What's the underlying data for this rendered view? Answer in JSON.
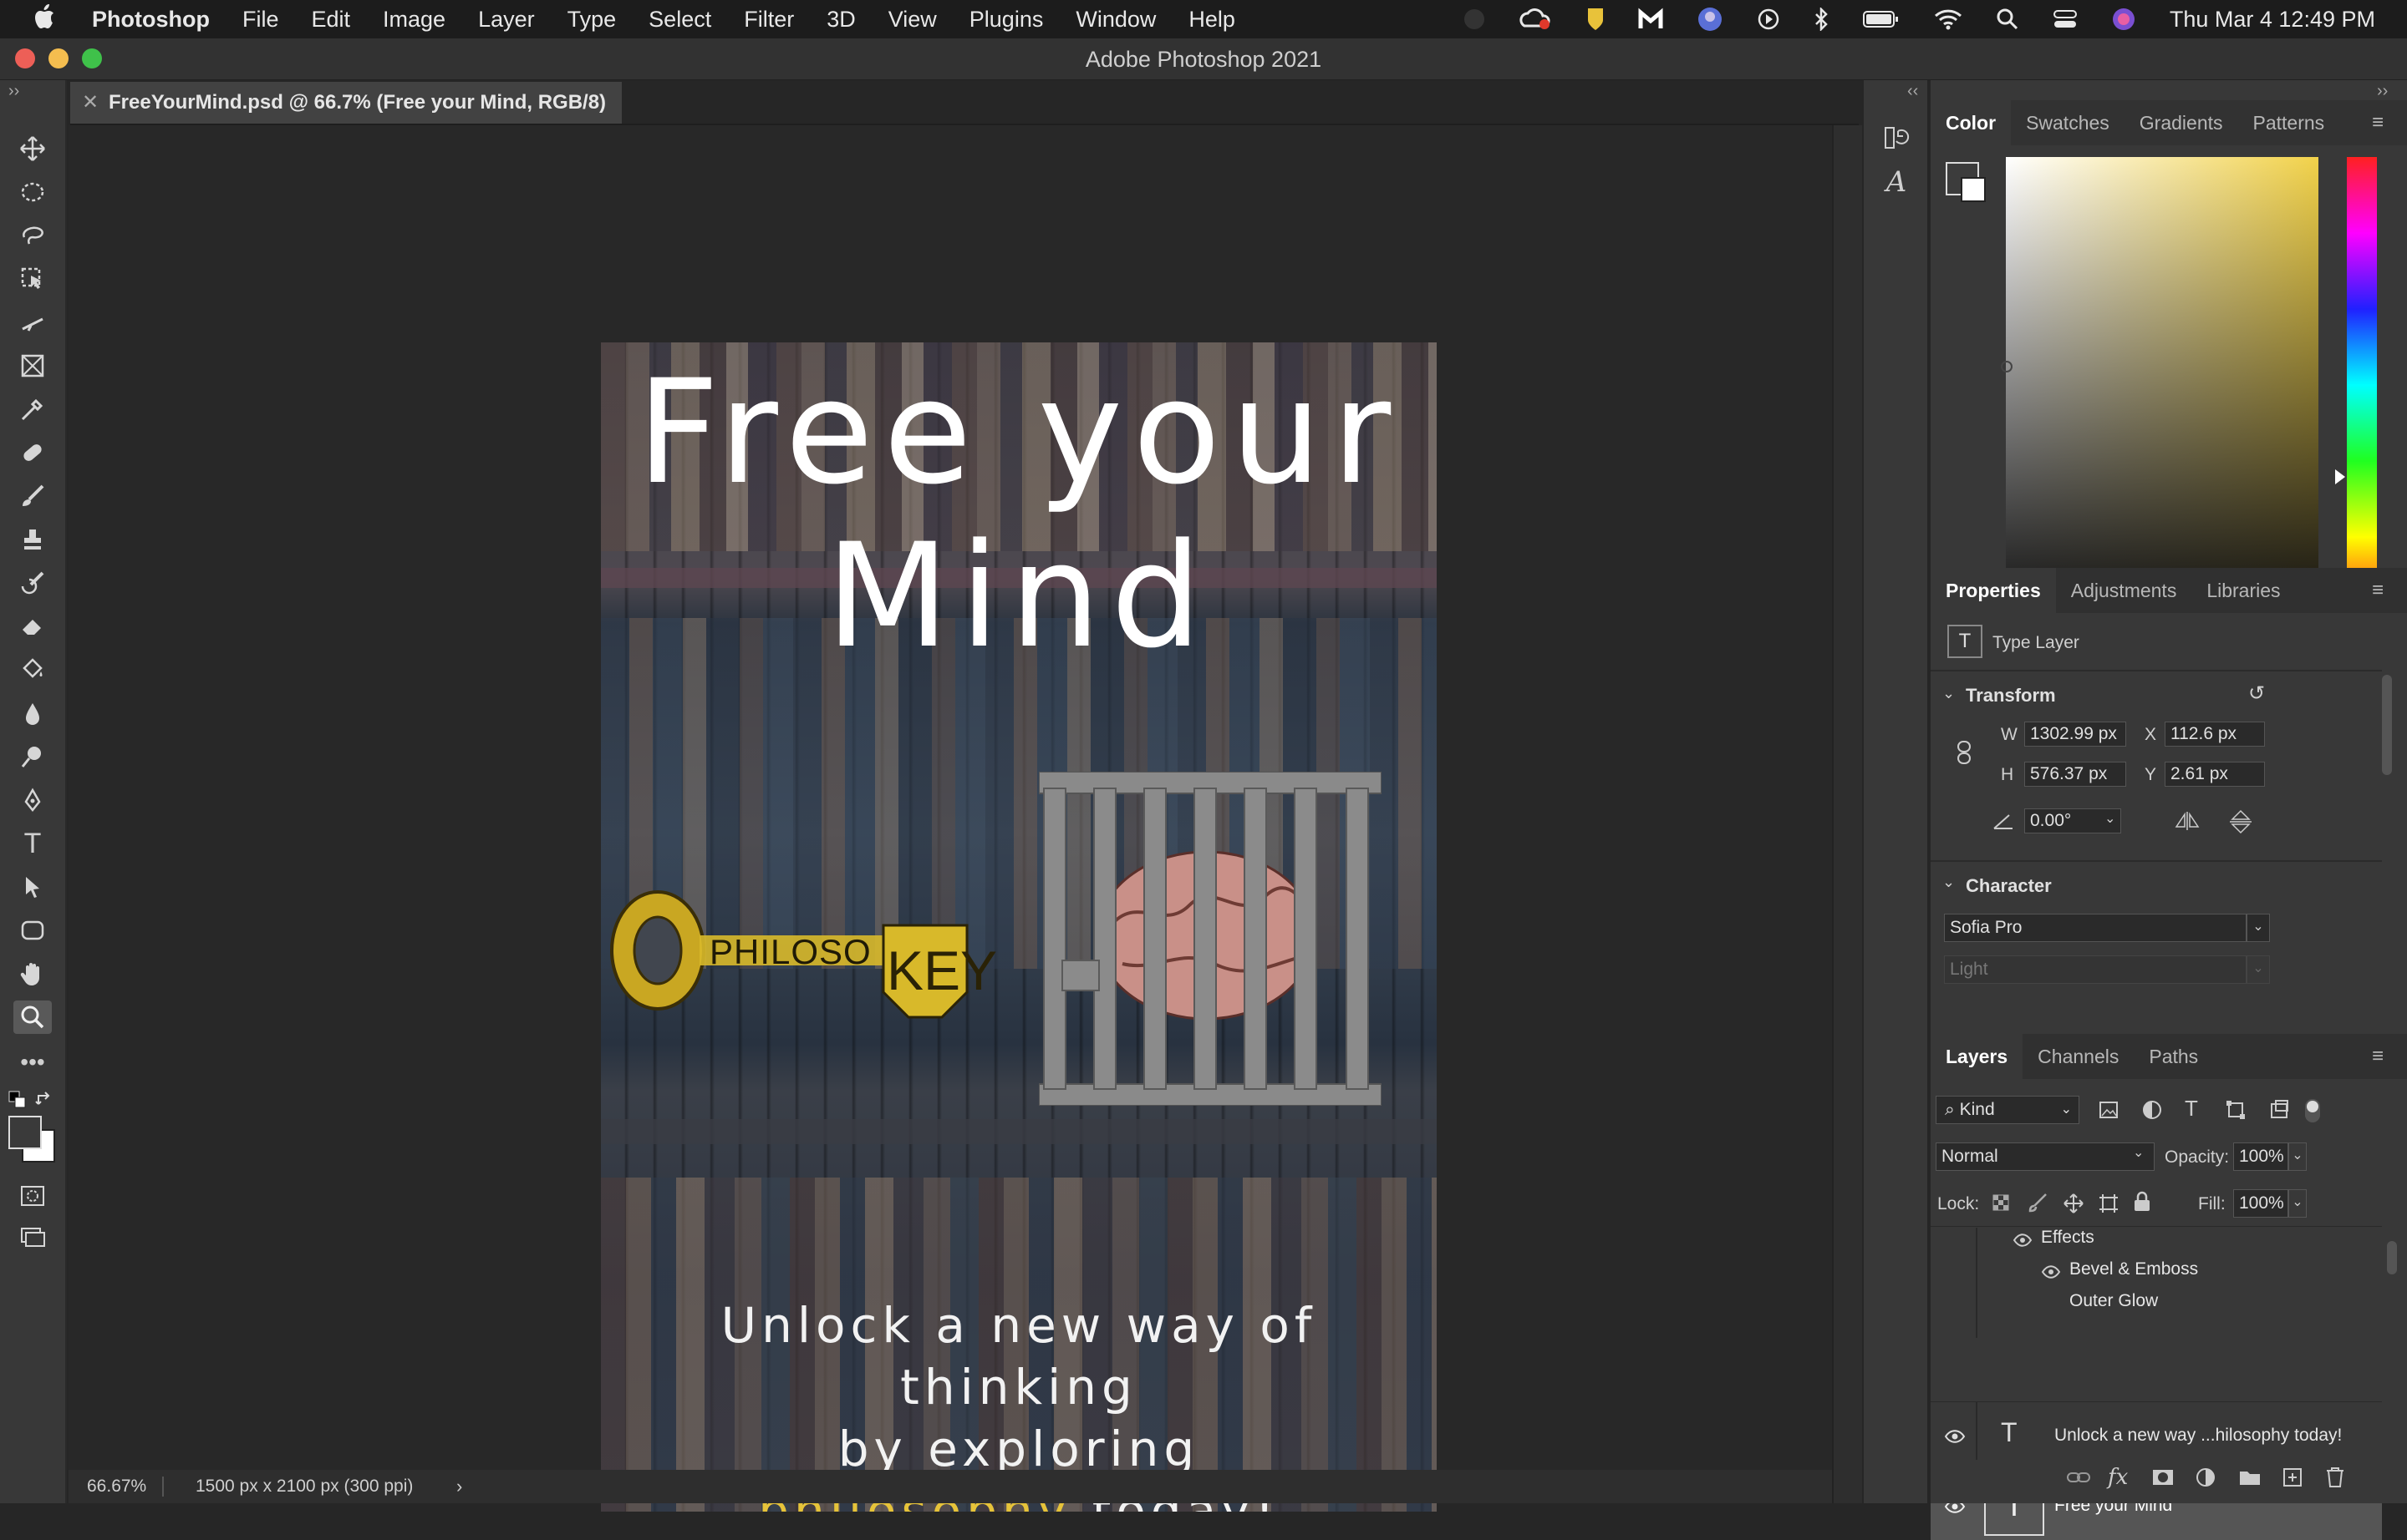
{
  "menubar": {
    "app": "Photoshop",
    "items": [
      "File",
      "Edit",
      "Image",
      "Layer",
      "Type",
      "Select",
      "Filter",
      "3D",
      "View",
      "Plugins",
      "Window",
      "Help"
    ],
    "clock": "Thu Mar 4  12:49 PM"
  },
  "window": {
    "title": "Adobe Photoshop 2021"
  },
  "document": {
    "tab_label": "FreeYourMind.psd @ 66.7% (Free your  Mind, RGB/8)",
    "headline_line1": "Free your",
    "headline_line2": "Mind",
    "key_text_a": "PHILOSO",
    "key_text_b": "KEY",
    "tagline_line1": "Unlock a new way of thinking",
    "tagline_line2": "by exploring",
    "tagline_highlight": "philosophy",
    "tagline_end": " today!"
  },
  "status": {
    "zoom": "66.67%",
    "doc_info": "1500 px x 2100 px (300 ppi)"
  },
  "color_panel": {
    "tabs": [
      "Color",
      "Swatches",
      "Gradients",
      "Patterns"
    ],
    "active": "Color",
    "hue_color": "#f2d24a"
  },
  "properties": {
    "tabs": [
      "Properties",
      "Adjustments",
      "Libraries"
    ],
    "layer_type": "Type Layer",
    "transform_title": "Transform",
    "w_label": "W",
    "w": "1302.99 px",
    "h_label": "H",
    "h": "576.37 px",
    "x_label": "X",
    "x": "112.6 px",
    "y_label": "Y",
    "y": "2.61 px",
    "angle": "0.00°",
    "character_title": "Character",
    "font": "Sofia Pro",
    "weight": "Light"
  },
  "layers": {
    "tabs": [
      "Layers",
      "Channels",
      "Paths"
    ],
    "filter_kind": "Kind",
    "blend": "Normal",
    "opacity_label": "Opacity:",
    "opacity": "100%",
    "lock_label": "Lock:",
    "fill_label": "Fill:",
    "fill": "100%",
    "effects_label": "Effects",
    "effect1": "Bevel & Emboss",
    "effect2": "Outer Glow",
    "row1": "Unlock a new way ...hilosophy today!",
    "row2": "Free your  Mind"
  }
}
